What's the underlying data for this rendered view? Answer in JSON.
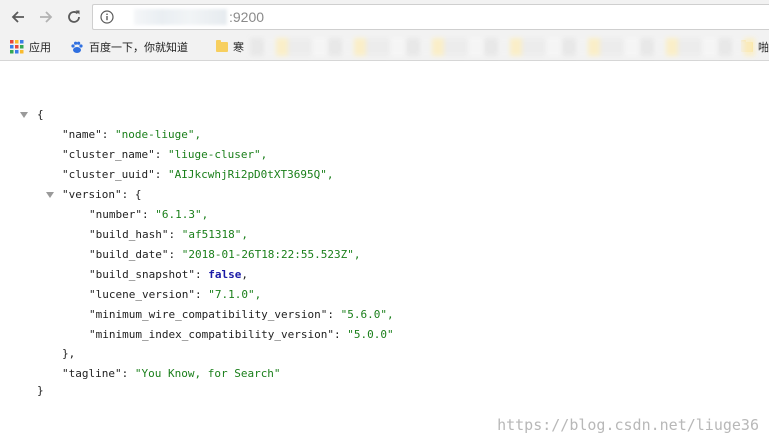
{
  "browser": {
    "url_host_visible": "",
    "url_port": ":9200",
    "bookmarks": [
      {
        "label": "应用",
        "icon": "apps-grid-icon"
      },
      {
        "label": "百度一下，你就知道",
        "icon": "baidu-paw-icon"
      },
      {
        "label": "寒",
        "icon": "folder-icon"
      },
      {
        "label": "啪",
        "icon": "folder-icon"
      }
    ]
  },
  "json": {
    "open_brace": "{",
    "close_brace": "}",
    "name_key": "\"name\":",
    "name_val": "\"node-liuge\",",
    "cluster_name_key": "\"cluster_name\":",
    "cluster_name_val": "\"liuge-cluser\",",
    "cluster_uuid_key": "\"cluster_uuid\":",
    "cluster_uuid_val": "\"AIJkcwhjRi2pD0tXT3695Q\",",
    "version_key": "\"version\":",
    "version_open": "{",
    "number_key": "\"number\":",
    "number_val": "\"6.1.3\",",
    "build_hash_key": "\"build_hash\":",
    "build_hash_val": "\"af51318\",",
    "build_date_key": "\"build_date\":",
    "build_date_val": "\"2018-01-26T18:22:55.523Z\",",
    "build_snapshot_key": "\"build_snapshot\":",
    "build_snapshot_val": "false",
    "build_snapshot_comma": ",",
    "lucene_version_key": "\"lucene_version\":",
    "lucene_version_val": "\"7.1.0\",",
    "min_wire_key": "\"minimum_wire_compatibility_version\":",
    "min_wire_val": "\"5.6.0\",",
    "min_index_key": "\"minimum_index_compatibility_version\":",
    "min_index_val": "\"5.0.0\"",
    "version_close": "},",
    "tagline_key": "\"tagline\":",
    "tagline_val": "\"You Know, for Search\""
  },
  "watermark": "https://blog.csdn.net/liuge36",
  "colors": {
    "string": "#1a7f1a",
    "boolean": "#1a1aa6",
    "chrome": "#f2f2f2"
  }
}
